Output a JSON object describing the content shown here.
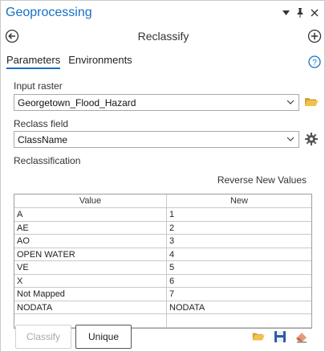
{
  "pane": {
    "title": "Geoprocessing"
  },
  "tool": {
    "title": "Reclassify"
  },
  "tabs": [
    {
      "label": "Parameters",
      "active": true
    },
    {
      "label": "Environments",
      "active": false
    }
  ],
  "input_raster": {
    "label": "Input raster",
    "value": "Georgetown_Flood_Hazard"
  },
  "reclass_field": {
    "label": "Reclass field",
    "value": "ClassName"
  },
  "reclassification": {
    "label": "Reclassification",
    "reverse_label": "Reverse New Values",
    "columns": [
      "Value",
      "New"
    ],
    "rows": [
      [
        "A",
        "1"
      ],
      [
        "AE",
        "2"
      ],
      [
        "AO",
        "3"
      ],
      [
        "OPEN WATER",
        "4"
      ],
      [
        "VE",
        "5"
      ],
      [
        "X",
        "6"
      ],
      [
        "Not Mapped",
        "7"
      ],
      [
        "NODATA",
        "NODATA"
      ],
      [
        "",
        ""
      ]
    ]
  },
  "buttons": {
    "classify": "Classify",
    "unique": "Unique"
  },
  "colors": {
    "accent": "#1a6fc2",
    "folder": "#e6b43c",
    "save": "#2f5aa8"
  }
}
